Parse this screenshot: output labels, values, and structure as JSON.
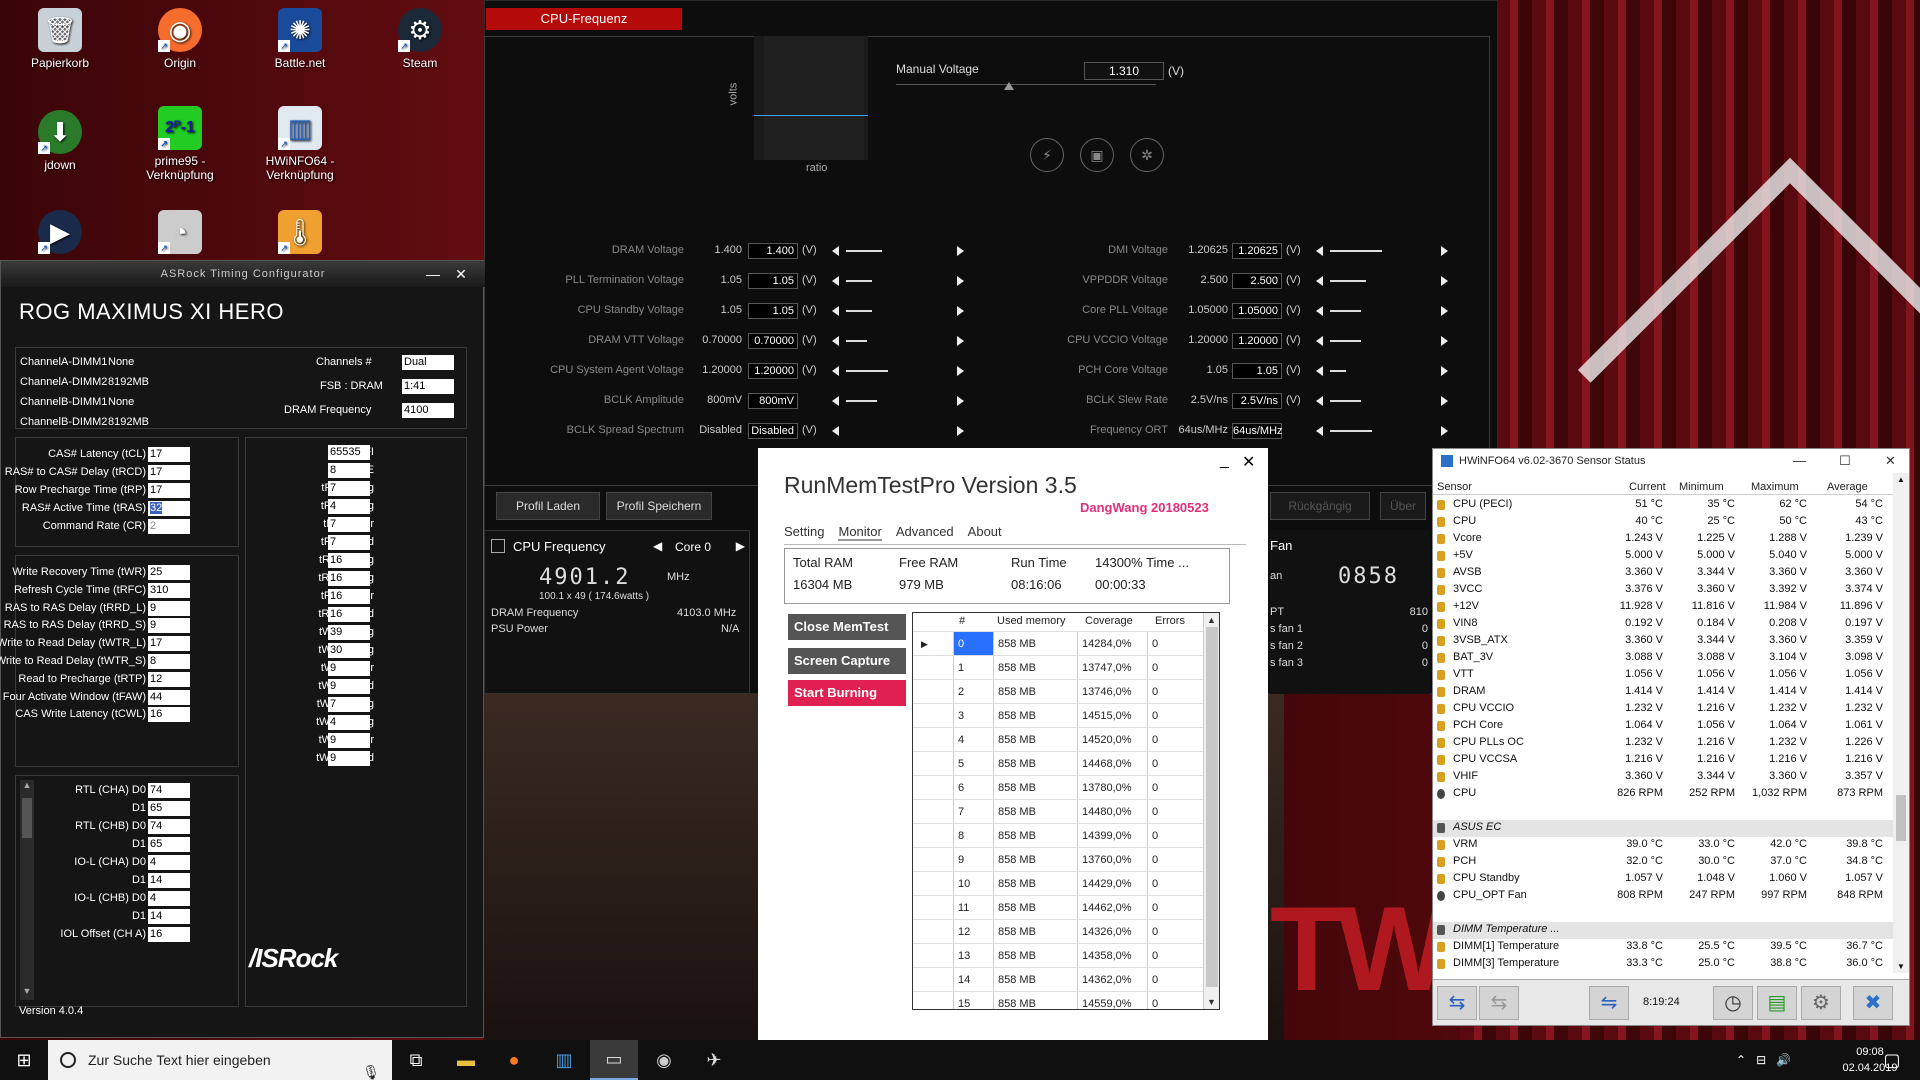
{
  "desktop": {
    "icons": [
      {
        "label": "Papierkorb",
        "icon": "recycle-bin-icon"
      },
      {
        "label": "Origin",
        "icon": "origin-icon"
      },
      {
        "label": "Battle.net",
        "icon": "battlenet-icon"
      },
      {
        "label": "Steam",
        "icon": "steam-icon"
      },
      {
        "label": "jdown",
        "icon": "jdownloader-icon"
      },
      {
        "label": "prime95 -\nVerknüpfung",
        "icon": "prime95-icon"
      },
      {
        "label": "HWiNFO64 -\nVerknüpfung",
        "icon": "hwinfo-icon"
      }
    ]
  },
  "oc": {
    "tab": "CPU-Frequenz",
    "graph_ylabel": "volts",
    "graph_xlabel": "ratio",
    "manual_voltage_label": "Manual Voltage",
    "manual_voltage_value": "1.310",
    "manual_voltage_unit": "(V)",
    "left_rows": [
      {
        "label": "DRAM Voltage",
        "val": "1.400",
        "box": "1.400",
        "unit": "(V)",
        "fill": 0.35
      },
      {
        "label": "PLL Termination Voltage",
        "val": "1.05",
        "box": "1.05",
        "unit": "(V)",
        "fill": 0.25
      },
      {
        "label": "CPU Standby Voltage",
        "val": "1.05",
        "box": "1.05",
        "unit": "(V)",
        "fill": 0.25
      },
      {
        "label": "DRAM VTT Voltage",
        "val": "0.70000",
        "box": "0.70000",
        "unit": "(V)",
        "fill": 0.2
      },
      {
        "label": "CPU System Agent Voltage",
        "val": "1.20000",
        "box": "1.20000",
        "unit": "(V)",
        "fill": 0.4
      },
      {
        "label": "BCLK Amplitude",
        "val": "800mV",
        "box": "800mV",
        "unit": "",
        "fill": 0.3
      },
      {
        "label": "BCLK Spread Spectrum",
        "val": "Disabled",
        "box": "Disabled",
        "unit": "(V)",
        "fill": 0
      }
    ],
    "right_rows": [
      {
        "label": "DMI Voltage",
        "val": "1.20625",
        "box": "1.20625",
        "unit": "(V)",
        "fill": 0.5
      },
      {
        "label": "VPPDDR Voltage",
        "val": "2.500",
        "box": "2.500",
        "unit": "(V)",
        "fill": 0.35
      },
      {
        "label": "Core PLL Voltage",
        "val": "1.05000",
        "box": "1.05000",
        "unit": "(V)",
        "fill": 0.3
      },
      {
        "label": "CPU VCCIO Voltage",
        "val": "1.20000",
        "box": "1.20000",
        "unit": "(V)",
        "fill": 0.3
      },
      {
        "label": "PCH Core Voltage",
        "val": "1.05",
        "box": "1.05",
        "unit": "(V)",
        "fill": 0.15
      },
      {
        "label": "BCLK Slew Rate",
        "val": "2.5V/ns",
        "box": "2.5V/ns",
        "unit": "(V)",
        "fill": 0.3
      },
      {
        "label": "Frequency ORT",
        "val": "64us/MHz",
        "box": "64us/MHz",
        "unit": "",
        "fill": 0.4
      }
    ],
    "profile_load": "Profil Laden",
    "profile_save": "Profil Speichern",
    "profile_back": "Rückgängig",
    "profile_apply": "Über",
    "cpu_freq_label": "CPU Frequency",
    "core_select": "Core 0",
    "freq_value": "4901.2",
    "freq_unit": "MHz",
    "freq_detail": "100.1  x  49   ( 174.6watts )",
    "dram_freq_label": "DRAM Frequency",
    "dram_freq_value": "4103.0  MHz",
    "psu_label": "PSU Power",
    "psu_value": "N/A",
    "fan_label": "Fan",
    "fan_value": "0858",
    "fan_rows": [
      {
        "label": "PT",
        "val": "810"
      },
      {
        "label": "s fan 1",
        "val": "0"
      },
      {
        "label": "s fan 2",
        "val": "0"
      },
      {
        "label": "s fan 3",
        "val": "0"
      }
    ],
    "fan_prefix": "an"
  },
  "asrock": {
    "title": "ASRock Timing Configurator",
    "board": "ROG MAXIMUS XI HERO",
    "dimms": [
      {
        "slot": "ChannelA-DIMM1",
        "size": "None"
      },
      {
        "slot": "ChannelA-DIMM2",
        "size": "8192MB"
      },
      {
        "slot": "ChannelB-DIMM1",
        "size": "None"
      },
      {
        "slot": "ChannelB-DIMM2",
        "size": "8192MB"
      }
    ],
    "channels_label": "Channels #",
    "channels_value": "Dual",
    "fsb_label": "FSB : DRAM",
    "fsb_value": "1:41",
    "dram_freq_label": "DRAM Frequency",
    "dram_freq_value": "4100",
    "primary": [
      {
        "label": "CAS# Latency (tCL)",
        "value": "17"
      },
      {
        "label": "RAS# to CAS# Delay (tRCD)",
        "value": "17"
      },
      {
        "label": "Row Precharge Time (tRP)",
        "value": "17"
      },
      {
        "label": "RAS# Active Time (tRAS)",
        "value": "32"
      },
      {
        "label": "Command Rate (CR)",
        "value": "2"
      }
    ],
    "secondary": [
      {
        "label": "Write Recovery Time (tWR)",
        "value": "25"
      },
      {
        "label": "Refresh Cycle Time (tRFC)",
        "value": "310"
      },
      {
        "label": "RAS to RAS Delay (tRRD_L)",
        "value": "9"
      },
      {
        "label": "RAS to RAS Delay (tRRD_S)",
        "value": "9"
      },
      {
        "label": "Write to Read Delay (tWTR_L)",
        "value": "17"
      },
      {
        "label": "Write to Read Delay (tWTR_S)",
        "value": "8"
      },
      {
        "label": "Read to Precharge (tRTP)",
        "value": "12"
      },
      {
        "label": "Four Activate Window (tFAW)",
        "value": "44"
      },
      {
        "label": "CAS Write Latency (tCWL)",
        "value": "16"
      }
    ],
    "rtl": [
      {
        "label": "RTL (CHA) D0",
        "value": "74"
      },
      {
        "label": "D1",
        "value": "65"
      },
      {
        "label": "RTL (CHB) D0",
        "value": "74"
      },
      {
        "label": "D1",
        "value": "65"
      },
      {
        "label": "IO-L (CHA) D0",
        "value": "4"
      },
      {
        "label": "D1",
        "value": "14"
      },
      {
        "label": "IO-L (CHB) D0",
        "value": "4"
      },
      {
        "label": "D1",
        "value": "14"
      },
      {
        "label": "IOL Offset (CH A)",
        "value": "16"
      }
    ],
    "tertiary": [
      {
        "label": "tREFI",
        "value": "65535"
      },
      {
        "label": "tCKE",
        "value": "8"
      },
      {
        "label": "tRDRD_sg",
        "value": "7"
      },
      {
        "label": "tRDRD_dg",
        "value": "4"
      },
      {
        "label": "tRDRD_dr",
        "value": "7"
      },
      {
        "label": "tRDRD_dd",
        "value": "7"
      },
      {
        "label": "tRDWR_sg",
        "value": "16"
      },
      {
        "label": "tRDWR_dg",
        "value": "16"
      },
      {
        "label": "tRDWR_dr",
        "value": "16"
      },
      {
        "label": "tRDWR_dd",
        "value": "16"
      },
      {
        "label": "tWRRD_sg",
        "value": "39"
      },
      {
        "label": "tWRRD_dg",
        "value": "30"
      },
      {
        "label": "tWRRD_dr",
        "value": "9"
      },
      {
        "label": "tWRRD_dd",
        "value": "9"
      },
      {
        "label": "tWRWR_sg",
        "value": "7"
      },
      {
        "label": "tWRWR_dg",
        "value": "4"
      },
      {
        "label": "tWRWR_dr",
        "value": "9"
      },
      {
        "label": "tWRWR_dd",
        "value": "9"
      }
    ],
    "logo": "/ISRock",
    "version": "Version 4.0.4"
  },
  "rmt": {
    "title": "RunMemTestPro Version 3.5",
    "subtitle": "DangWang  20180523",
    "tabs": [
      "Setting",
      "Monitor",
      "Advanced",
      "About"
    ],
    "active_tab": "Monitor",
    "stats_headers": [
      "Total RAM",
      "Free RAM",
      "Run Time",
      "14300% Time ..."
    ],
    "stats_values": [
      "16304 MB",
      "979 MB",
      "08:16:06",
      "00:00:33"
    ],
    "btn_close": "Close MemTest",
    "btn_capture": "Screen Capture",
    "btn_burn": "Start Burning",
    "grid_headers": [
      "#",
      "Used memory",
      "Coverage",
      "Errors"
    ],
    "rows": [
      [
        "0",
        "858 MB",
        "14284,0%",
        "0"
      ],
      [
        "1",
        "858 MB",
        "13747,0%",
        "0"
      ],
      [
        "2",
        "858 MB",
        "13746,0%",
        "0"
      ],
      [
        "3",
        "858 MB",
        "14515,0%",
        "0"
      ],
      [
        "4",
        "858 MB",
        "14520,0%",
        "0"
      ],
      [
        "5",
        "858 MB",
        "14468,0%",
        "0"
      ],
      [
        "6",
        "858 MB",
        "13780,0%",
        "0"
      ],
      [
        "7",
        "858 MB",
        "14480,0%",
        "0"
      ],
      [
        "8",
        "858 MB",
        "14399,0%",
        "0"
      ],
      [
        "9",
        "858 MB",
        "13760,0%",
        "0"
      ],
      [
        "10",
        "858 MB",
        "14429,0%",
        "0"
      ],
      [
        "11",
        "858 MB",
        "14462,0%",
        "0"
      ],
      [
        "12",
        "858 MB",
        "14326,0%",
        "0"
      ],
      [
        "13",
        "858 MB",
        "14358,0%",
        "0"
      ],
      [
        "14",
        "858 MB",
        "14362,0%",
        "0"
      ],
      [
        "15",
        "858 MB",
        "14559,0%",
        "0"
      ]
    ]
  },
  "hwinfo": {
    "title": "HWiNFO64 v6.02-3670 Sensor Status",
    "headers": [
      "Sensor",
      "Current",
      "Minimum",
      "Maximum",
      "Average"
    ],
    "rows": [
      {
        "t": "temp",
        "name": "CPU (PECI)",
        "cur": "51 °C",
        "min": "35 °C",
        "max": "62 °C",
        "avg": "54 °C"
      },
      {
        "t": "temp",
        "name": "CPU",
        "cur": "40 °C",
        "min": "25 °C",
        "max": "50 °C",
        "avg": "43 °C"
      },
      {
        "t": "volt",
        "name": "Vcore",
        "cur": "1.243 V",
        "min": "1.225 V",
        "max": "1.288 V",
        "avg": "1.239 V"
      },
      {
        "t": "volt",
        "name": "+5V",
        "cur": "5.000 V",
        "min": "5.000 V",
        "max": "5.040 V",
        "avg": "5.000 V"
      },
      {
        "t": "volt",
        "name": "AVSB",
        "cur": "3.360 V",
        "min": "3.344 V",
        "max": "3.360 V",
        "avg": "3.360 V"
      },
      {
        "t": "volt",
        "name": "3VCC",
        "cur": "3.376 V",
        "min": "3.360 V",
        "max": "3.392 V",
        "avg": "3.374 V"
      },
      {
        "t": "volt",
        "name": "+12V",
        "cur": "11.928 V",
        "min": "11.816 V",
        "max": "11.984 V",
        "avg": "11.896 V"
      },
      {
        "t": "volt",
        "name": "VIN8",
        "cur": "0.192 V",
        "min": "0.184 V",
        "max": "0.208 V",
        "avg": "0.197 V"
      },
      {
        "t": "volt",
        "name": "3VSB_ATX",
        "cur": "3.360 V",
        "min": "3.344 V",
        "max": "3.360 V",
        "avg": "3.359 V"
      },
      {
        "t": "volt",
        "name": "BAT_3V",
        "cur": "3.088 V",
        "min": "3.088 V",
        "max": "3.104 V",
        "avg": "3.098 V"
      },
      {
        "t": "volt",
        "name": "VTT",
        "cur": "1.056 V",
        "min": "1.056 V",
        "max": "1.056 V",
        "avg": "1.056 V"
      },
      {
        "t": "volt",
        "name": "DRAM",
        "cur": "1.414 V",
        "min": "1.414 V",
        "max": "1.414 V",
        "avg": "1.414 V"
      },
      {
        "t": "volt",
        "name": "CPU VCCIO",
        "cur": "1.232 V",
        "min": "1.216 V",
        "max": "1.232 V",
        "avg": "1.232 V"
      },
      {
        "t": "volt",
        "name": "PCH Core",
        "cur": "1.064 V",
        "min": "1.056 V",
        "max": "1.064 V",
        "avg": "1.061 V"
      },
      {
        "t": "volt",
        "name": "CPU PLLs OC",
        "cur": "1.232 V",
        "min": "1.216 V",
        "max": "1.232 V",
        "avg": "1.226 V"
      },
      {
        "t": "volt",
        "name": "CPU VCCSA",
        "cur": "1.216 V",
        "min": "1.216 V",
        "max": "1.216 V",
        "avg": "1.216 V"
      },
      {
        "t": "volt",
        "name": "VHIF",
        "cur": "3.360 V",
        "min": "3.344 V",
        "max": "3.360 V",
        "avg": "3.357 V"
      },
      {
        "t": "fan",
        "name": "CPU",
        "cur": "826 RPM",
        "min": "252 RPM",
        "max": "1,032 RPM",
        "avg": "873 RPM"
      },
      {
        "t": "blank",
        "name": "",
        "cur": "",
        "min": "",
        "max": "",
        "avg": ""
      },
      {
        "t": "grp",
        "name": "ASUS EC",
        "cur": "",
        "min": "",
        "max": "",
        "avg": ""
      },
      {
        "t": "temp",
        "name": "VRM",
        "cur": "39.0 °C",
        "min": "33.0 °C",
        "max": "42.0 °C",
        "avg": "39.8 °C"
      },
      {
        "t": "temp",
        "name": "PCH",
        "cur": "32.0 °C",
        "min": "30.0 °C",
        "max": "37.0 °C",
        "avg": "34.8 °C"
      },
      {
        "t": "volt",
        "name": "CPU Standby",
        "cur": "1.057 V",
        "min": "1.048 V",
        "max": "1.060 V",
        "avg": "1.057 V"
      },
      {
        "t": "fan",
        "name": "CPU_OPT Fan",
        "cur": "808 RPM",
        "min": "247 RPM",
        "max": "997 RPM",
        "avg": "848 RPM"
      },
      {
        "t": "blank",
        "name": "",
        "cur": "",
        "min": "",
        "max": "",
        "avg": ""
      },
      {
        "t": "grp",
        "name": "DIMM Temperature ...",
        "cur": "",
        "min": "",
        "max": "",
        "avg": ""
      },
      {
        "t": "temp",
        "name": "DIMM[1] Temperature",
        "cur": "33.8 °C",
        "min": "25.5 °C",
        "max": "39.5 °C",
        "avg": "36.7 °C"
      },
      {
        "t": "temp",
        "name": "DIMM[3] Temperature",
        "cur": "33.3 °C",
        "min": "25.0 °C",
        "max": "38.8 °C",
        "avg": "36.0 °C"
      }
    ],
    "elapsed": "8:19:24"
  },
  "taskbar": {
    "search_placeholder": "Zur Suche Text hier eingeben",
    "time": "09:08",
    "date": "02.04.2019"
  }
}
